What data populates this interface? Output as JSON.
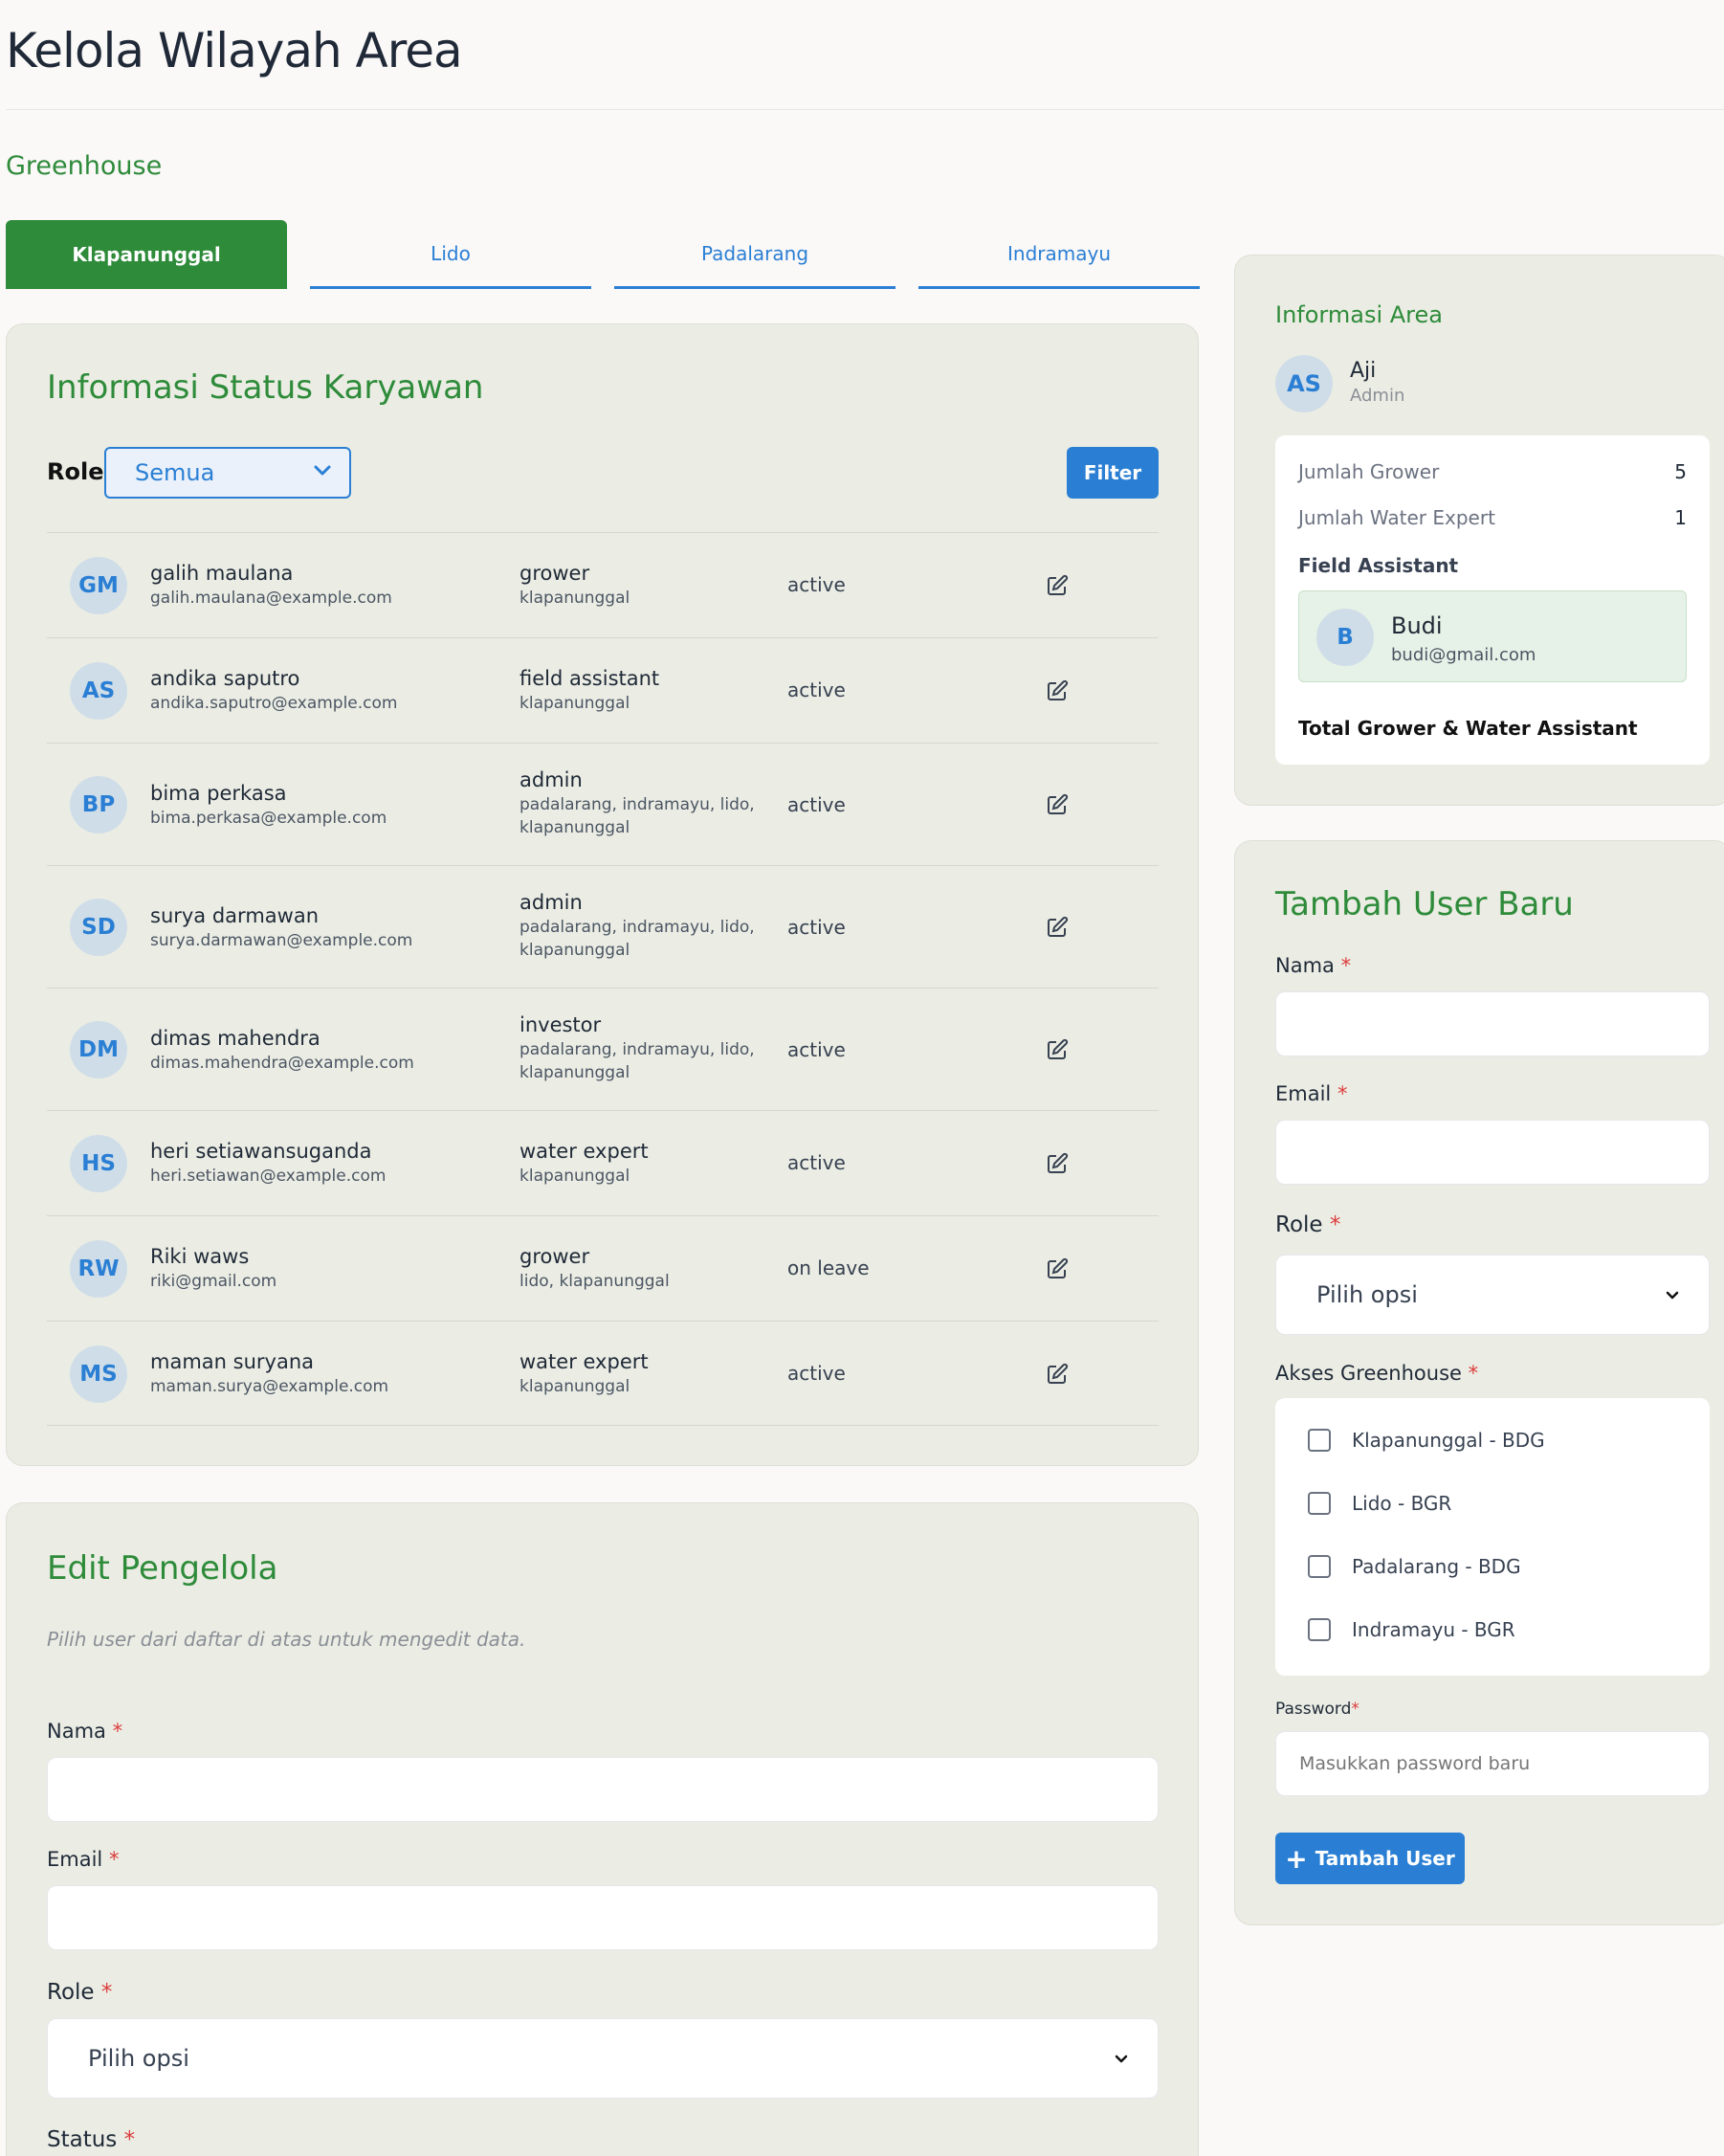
{
  "header": {
    "title": "Kelola Wilayah Area",
    "section": "Greenhouse"
  },
  "tabs": [
    {
      "label": "Klapanunggal",
      "active": true
    },
    {
      "label": "Lido",
      "active": false
    },
    {
      "label": "Padalarang",
      "active": false
    },
    {
      "label": "Indramayu",
      "active": false
    }
  ],
  "employees": {
    "title": "Informasi Status Karyawan",
    "role_label": "Role",
    "role_filter_value": "Semua",
    "filter_button": "Filter",
    "rows": [
      {
        "initials": "GM",
        "name": "galih maulana",
        "email": "galih.maulana@example.com",
        "role": "grower",
        "area": "klapanunggal",
        "status": "active"
      },
      {
        "initials": "AS",
        "name": "andika saputro",
        "email": "andika.saputro@example.com",
        "role": "field assistant",
        "area": "klapanunggal",
        "status": "active"
      },
      {
        "initials": "BP",
        "name": "bima perkasa",
        "email": "bima.perkasa@example.com",
        "role": "admin",
        "area": "padalarang, indramayu, lido, klapanunggal",
        "status": "active"
      },
      {
        "initials": "SD",
        "name": "surya darmawan",
        "email": "surya.darmawan@example.com",
        "role": "admin",
        "area": "padalarang, indramayu, lido, klapanunggal",
        "status": "active"
      },
      {
        "initials": "DM",
        "name": "dimas mahendra",
        "email": "dimas.mahendra@example.com",
        "role": "investor",
        "area": "padalarang, indramayu, lido, klapanunggal",
        "status": "active"
      },
      {
        "initials": "HS",
        "name": "heri setiawansuganda",
        "email": "heri.setiawan@example.com",
        "role": "water expert",
        "area": "klapanunggal",
        "status": "active"
      },
      {
        "initials": "RW",
        "name": "Riki waws",
        "email": "riki@gmail.com",
        "role": "grower",
        "area": "lido, klapanunggal",
        "status": "on leave"
      },
      {
        "initials": "MS",
        "name": "maman suryana",
        "email": "maman.surya@example.com",
        "role": "water expert",
        "area": "klapanunggal",
        "status": "active"
      }
    ]
  },
  "edit_form": {
    "title": "Edit Pengelola",
    "hint": "Pilih user dari daftar di atas untuk mengedit data.",
    "name_label": "Nama",
    "email_label": "Email",
    "role_label": "Role",
    "role_value": "Pilih opsi",
    "status_label": "Status",
    "required_mark": "*"
  },
  "area_info": {
    "title": "Informasi Area",
    "user_initials": "AS",
    "user_name": "Aji",
    "user_role": "Admin",
    "grower_label": "Jumlah Grower",
    "grower_count": "5",
    "water_expert_label": "Jumlah Water Expert",
    "water_expert_count": "1",
    "field_assistant_title": "Field Assistant",
    "field_assistant": {
      "initials": "B",
      "name": "Budi",
      "email": "budi@gmail.com"
    },
    "total_label": "Total Grower & Water Assistant"
  },
  "add_user": {
    "title": "Tambah User Baru",
    "name_label": "Nama",
    "email_label": "Email",
    "role_label": "Role",
    "role_value": "Pilih opsi",
    "access_label": "Akses Greenhouse",
    "access_options": [
      "Klapanunggal - BDG",
      "Lido - BGR",
      "Padalarang - BDG",
      "Indramayu - BGR"
    ],
    "password_label": "Password",
    "password_placeholder": "Masukkan password baru",
    "submit_button": "Tambah User",
    "required_mark": "*"
  },
  "colors": {
    "brand_green": "#2e8b3a",
    "accent_blue": "#2a7fd4",
    "required_red": "#dc3c3c"
  }
}
